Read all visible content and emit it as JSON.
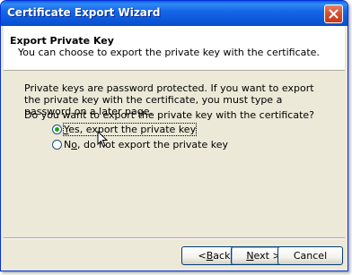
{
  "window": {
    "title": "Certificate Export Wizard",
    "close_icon": "close-icon"
  },
  "header": {
    "title": "Export Private Key",
    "subtitle": "You can choose to export the private key with the certificate."
  },
  "body": {
    "info": "Private keys are password protected. If you want to export the private key with the certificate, you must type a password on a later page.",
    "question": "Do you want to export the private key with the certificate?"
  },
  "options": [
    {
      "prefix": "",
      "mnemonic": "Y",
      "rest": "es, export the private key",
      "selected": true
    },
    {
      "prefix": "N",
      "mnemonic": "o",
      "rest": ", do not export the private key",
      "selected": false
    }
  ],
  "buttons": {
    "back_prefix": "< ",
    "back_mnemonic": "B",
    "back_rest": "ack",
    "next_mnemonic": "N",
    "next_rest": "ext >",
    "cancel": "Cancel"
  },
  "colors": {
    "titlebar": "#0a5ee0",
    "radio_dot": "#21a121",
    "face": "#ece9d8"
  }
}
